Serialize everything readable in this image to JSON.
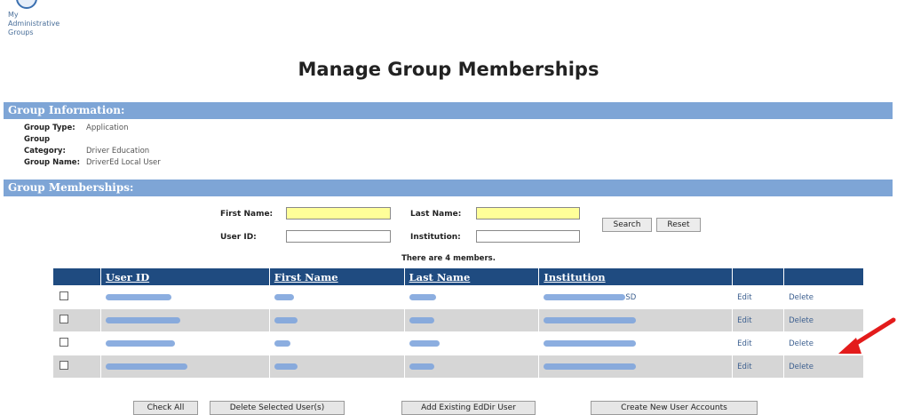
{
  "nav": {
    "label_line1": "My",
    "label_line2": "Administrative",
    "label_line3": "Groups"
  },
  "page": {
    "title": "Manage Group Memberships"
  },
  "group_info": {
    "header": "Group Information:",
    "type_label": "Group Type:",
    "type_value": "Application",
    "category_label": "Group Category:",
    "category_value": "Driver Education",
    "name_label": "Group Name:",
    "name_value": "DriverEd Local User"
  },
  "memberships": {
    "header": "Group Memberships:",
    "first_name_label": "First Name:",
    "last_name_label": "Last Name:",
    "user_id_label": "User ID:",
    "institution_label": "Institution:",
    "first_name_value": "",
    "last_name_value": "",
    "user_id_value": "",
    "institution_value": "",
    "search_button": "Search",
    "reset_button": "Reset",
    "count_text": "There are 4 members."
  },
  "table": {
    "columns": [
      "User ID",
      "First Name",
      "Last Name",
      "Institution"
    ],
    "rows": [
      {
        "edit": "Edit",
        "delete": "Delete",
        "institution_suffix": "SD"
      },
      {
        "edit": "Edit",
        "delete": "Delete",
        "institution_suffix": ""
      },
      {
        "edit": "Edit",
        "delete": "Delete",
        "institution_suffix": ""
      },
      {
        "edit": "Edit",
        "delete": "Delete",
        "institution_suffix": ""
      }
    ]
  },
  "buttons": {
    "check_all": "Check All",
    "delete_selected": "Delete Selected User(s)",
    "add_existing": "Add Existing EdDir User",
    "create_new": "Create New User Accounts"
  },
  "colors": {
    "section_bar": "#7ea5d6",
    "table_header": "#1f4b80",
    "highlight_input": "#ffff99",
    "arrow": "#e31b1b"
  }
}
